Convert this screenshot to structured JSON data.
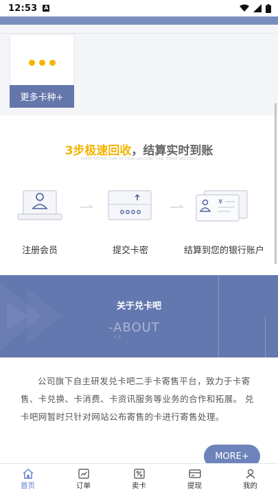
{
  "status_bar": {
    "time": "12:53",
    "sim_label": "A"
  },
  "top": {
    "more_card_label": "更多卡种+"
  },
  "steps": {
    "title_highlight": "3步极速回收",
    "title_rest": "，结算实时到账",
    "subtitle": "RAPID EXTRACTION OF CASH ACCOUNT FOR THREE SECONDS",
    "items": [
      {
        "label": "注册会员",
        "icon": "user-monitor-icon"
      },
      {
        "label": "提交卡密",
        "icon": "card-upload-icon"
      },
      {
        "label": "结算到您的银行账户",
        "icon": "bank-account-icon"
      }
    ]
  },
  "about": {
    "title": "关于兑卡吧",
    "en_title": "-ABOUT",
    "en_sub": "US"
  },
  "description": "公司旗下自主研发兑卡吧二手卡寄售平台，致力于卡寄售、卡兑换、卡消费、卡资讯服务等业务的合作和拓展。 兑卡吧网暂时只针对网站公布寄售的卡进行寄售处理。",
  "more_button": "MORE+",
  "nav": [
    {
      "label": "首页",
      "icon": "home-icon",
      "active": true
    },
    {
      "label": "订单",
      "icon": "order-chart-icon",
      "active": false
    },
    {
      "label": "卖卡",
      "icon": "sell-card-icon",
      "active": false
    },
    {
      "label": "提现",
      "icon": "withdraw-card-icon",
      "active": false
    },
    {
      "label": "我的",
      "icon": "profile-icon",
      "active": false
    }
  ],
  "colors": {
    "accent": "#f5b400",
    "primary": "#6478b0",
    "nav_active": "#5b7ad2"
  }
}
